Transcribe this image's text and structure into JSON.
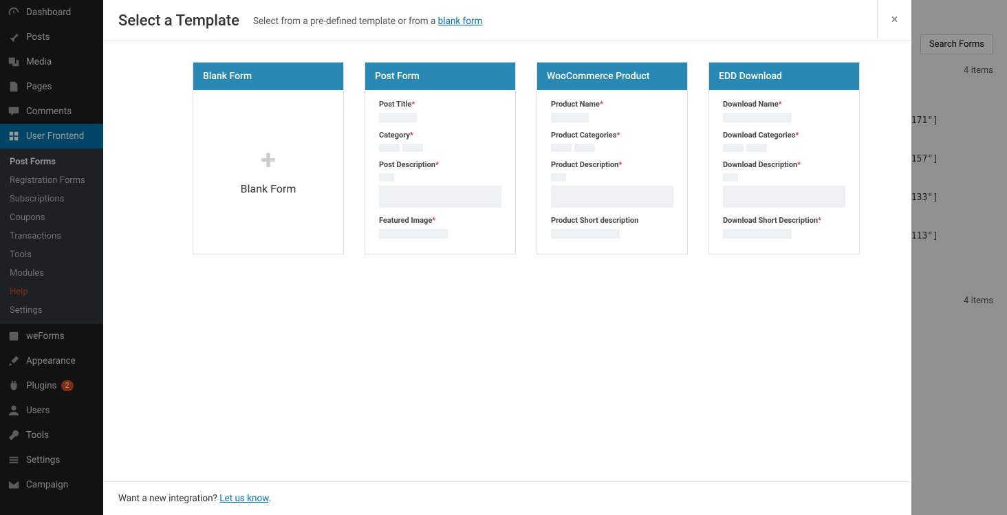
{
  "sidebar": {
    "items": [
      {
        "label": "Dashboard",
        "icon": "gauge"
      },
      {
        "label": "Posts",
        "icon": "pin"
      },
      {
        "label": "Media",
        "icon": "media"
      },
      {
        "label": "Pages",
        "icon": "pages"
      },
      {
        "label": "Comments",
        "icon": "comment"
      },
      {
        "label": "User Frontend",
        "icon": "wpuf",
        "active": true
      },
      {
        "label": "weForms",
        "icon": "weforms"
      },
      {
        "label": "Appearance",
        "icon": "brush"
      },
      {
        "label": "Plugins",
        "icon": "plug",
        "badge": "2"
      },
      {
        "label": "Users",
        "icon": "user"
      },
      {
        "label": "Tools",
        "icon": "wrench"
      },
      {
        "label": "Settings",
        "icon": "sliders"
      },
      {
        "label": "Campaign",
        "icon": "mail"
      }
    ],
    "sub": [
      {
        "label": "Post Forms",
        "active": true
      },
      {
        "label": "Registration Forms"
      },
      {
        "label": "Subscriptions"
      },
      {
        "label": "Coupons"
      },
      {
        "label": "Transactions"
      },
      {
        "label": "Tools"
      },
      {
        "label": "Modules"
      },
      {
        "label": "Help",
        "help": true
      },
      {
        "label": "Settings"
      }
    ]
  },
  "main": {
    "search_button": "Search Forms",
    "items_count": "4 items",
    "shortcodes": [
      "171\"]",
      "157\"]",
      "133\"]",
      "113\"]"
    ]
  },
  "modal": {
    "title": "Select a Template",
    "subtitle_prefix": "Select from a pre-defined template or from a ",
    "subtitle_link": "blank form",
    "close": "×",
    "footer_text": "Want a new integration? ",
    "footer_link": "Let us know",
    "footer_period": ".",
    "templates": {
      "blank": {
        "title": "Blank Form",
        "label": "Blank Form"
      },
      "post": {
        "title": "Post Form",
        "fields": [
          "Post Title",
          "Category",
          "Post Description",
          "Featured Image"
        ],
        "required": [
          true,
          true,
          true,
          true
        ]
      },
      "woo": {
        "title": "WooCommerce Product",
        "fields": [
          "Product Name",
          "Product Categories",
          "Product Description",
          "Product Short description"
        ],
        "required": [
          true,
          true,
          true,
          false
        ]
      },
      "edd": {
        "title": "EDD Download",
        "fields": [
          "Download Name",
          "Download Categories",
          "Download Description",
          "Download Short Description"
        ],
        "required": [
          true,
          true,
          true,
          true
        ]
      }
    }
  }
}
